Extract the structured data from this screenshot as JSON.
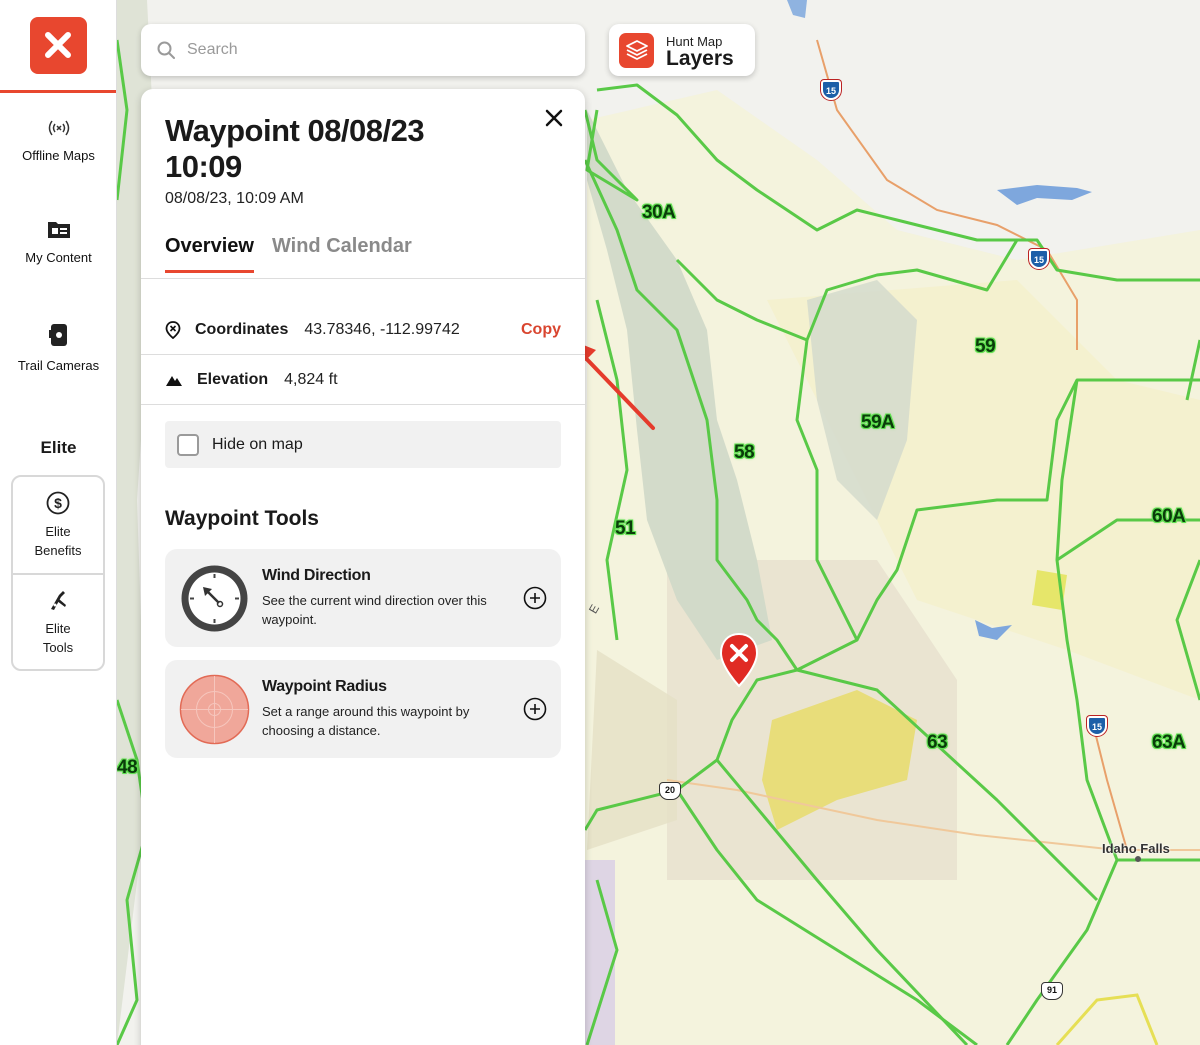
{
  "app": {
    "brand_color": "#e8472f"
  },
  "sidebar": {
    "items": [
      {
        "label": "Offline Maps",
        "icon": "offline-broadcast-icon"
      },
      {
        "label": "My Content",
        "icon": "folder-content-icon"
      },
      {
        "label": "Trail Cameras",
        "icon": "trail-camera-icon"
      }
    ],
    "elite_title": "Elite",
    "elite_items": [
      {
        "label": "Elite Benefits",
        "icon": "dollar-circle-icon"
      },
      {
        "label": "Elite Tools",
        "icon": "multitool-icon"
      }
    ]
  },
  "search": {
    "placeholder": "Search"
  },
  "layers": {
    "small": "Hunt Map",
    "big": "Layers"
  },
  "panel": {
    "title": "Waypoint 08/08/23 10:09",
    "subtitle": "08/08/23, 10:09 AM",
    "tabs": [
      {
        "label": "Overview",
        "active": true
      },
      {
        "label": "Wind Calendar",
        "active": false
      }
    ],
    "coordinates": {
      "label": "Coordinates",
      "value": "43.78346, -112.99742",
      "copy_label": "Copy"
    },
    "elevation": {
      "label": "Elevation",
      "value": "4,824 ft"
    },
    "hide_on_map": {
      "label": "Hide on map",
      "checked": false
    },
    "tools_title": "Waypoint Tools",
    "tools": [
      {
        "name": "Wind Direction",
        "desc": "See the current wind direction over this waypoint.",
        "icon": "wind-dial-icon"
      },
      {
        "name": "Waypoint Radius",
        "desc": "Set a range around this waypoint by choosing a distance.",
        "icon": "radius-target-icon"
      }
    ]
  },
  "map": {
    "unit_labels": [
      "30A",
      "59",
      "59A",
      "58",
      "51",
      "60A",
      "63",
      "63A",
      "48"
    ],
    "city": "Idaho Falls",
    "interstate_shields": [
      "15",
      "15",
      "15"
    ],
    "us_shields": [
      "20",
      "91"
    ],
    "road_letter": "E"
  }
}
